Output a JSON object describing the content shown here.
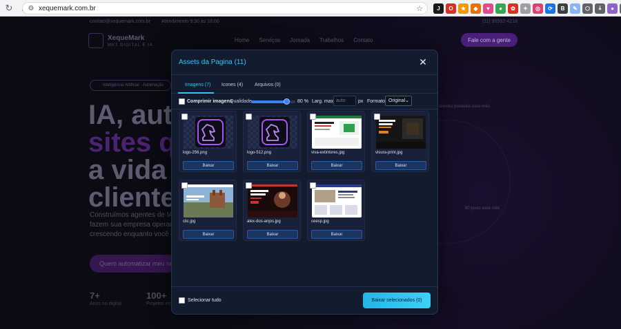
{
  "browser": {
    "url": "xequemark.com.br",
    "extensions": [
      {
        "icon": "ext-1-icon",
        "color": "#1a1a1a",
        "glyph": "J"
      },
      {
        "icon": "ext-2-icon",
        "color": "#d93025",
        "glyph": "O"
      },
      {
        "icon": "ext-3-icon",
        "color": "#f29900",
        "glyph": "★"
      },
      {
        "icon": "ext-4-icon",
        "color": "#e8710a",
        "glyph": "◆"
      },
      {
        "icon": "ext-5-icon",
        "color": "#e24a8d",
        "glyph": "♥"
      },
      {
        "icon": "ext-6-icon",
        "color": "#34a853",
        "glyph": "●"
      },
      {
        "icon": "ext-7-icon",
        "color": "#d93025",
        "glyph": "✿"
      },
      {
        "icon": "ext-8-icon",
        "color": "#9aa0a6",
        "glyph": "✦"
      },
      {
        "icon": "ext-9-icon",
        "color": "#e04070",
        "glyph": "◎"
      },
      {
        "icon": "ext-10-icon",
        "color": "#1a73e8",
        "glyph": "⟳"
      },
      {
        "icon": "ext-11-icon",
        "color": "#3c4043",
        "glyph": "B"
      },
      {
        "icon": "ext-12-icon",
        "color": "#8ab4f8",
        "glyph": "✎"
      },
      {
        "icon": "ext-13-icon",
        "color": "#5f6368",
        "glyph": "⬡"
      },
      {
        "icon": "download-icon",
        "color": "#5f6368",
        "glyph": "⤓"
      },
      {
        "icon": "profile-icon",
        "color": "#8e63ce",
        "glyph": "●"
      },
      {
        "icon": "menu-icon",
        "color": "#5f6368",
        "glyph": "⋮"
      }
    ]
  },
  "site": {
    "topbar_email": "contato@xequemark.com.br",
    "topbar_hours": "Atendimento 9:30 às 18:00",
    "topbar_phone": "(11) 96592-4218",
    "logo_name": "XequeMark",
    "logo_sub": "MKT DIGITAL E IA",
    "menu": [
      "Home",
      "Serviços",
      "Jornada",
      "Trabalhos",
      "Contato"
    ],
    "cta": "Fale com a gente",
    "pill": "Inteligência Artificial · Automação",
    "hero_lines": [
      "IA, auto",
      "sites qu",
      "a vida d",
      "clientes"
    ],
    "sub_lines": [
      "Construímos agentes de IA",
      "fazem sua empresa operar",
      "crescendo enquanto você d"
    ],
    "hero_button": "Quero automatizar meu ne",
    "stats": [
      {
        "value": "7+",
        "label": "Anos no digital"
      },
      {
        "value": "100+",
        "label": "Projetos entregues"
      }
    ],
    "bubble_1": "clientes postados esse mês",
    "bubble_2": "80 posts esse mês"
  },
  "modal": {
    "title": "Assets da Pagina (11)",
    "tabs": [
      {
        "label": "Imagens (7)",
        "active": true
      },
      {
        "label": "Icones (4)",
        "active": false
      },
      {
        "label": "Arquivos (0)",
        "active": false
      }
    ],
    "compress_label": "Comprimir imagens",
    "quality_label": "Qualidade",
    "quality_value": 80,
    "quality_text": "80 %",
    "max_width_label": "Larg. max",
    "max_width_placeholder": "auto",
    "px_label": "px",
    "format_label": "Formato",
    "format_value": "Original",
    "download_label": "Baixar",
    "assets": [
      {
        "file": "logo-256.png",
        "kind": "logo"
      },
      {
        "file": "logo-512.png",
        "kind": "logo"
      },
      {
        "file": "viva-extintores.jpg",
        "kind": "site-light"
      },
      {
        "file": "visura-print.jpg",
        "kind": "site-dark"
      },
      {
        "file": "clic.jpg",
        "kind": "site-photo"
      },
      {
        "file": "alex-dos-anjos.jpg",
        "kind": "site-red"
      },
      {
        "file": "ceesp.jpg",
        "kind": "site-white"
      }
    ],
    "select_all_label": "Selecionar tudo",
    "download_selected_label": "Baixar selecionados (0)"
  }
}
